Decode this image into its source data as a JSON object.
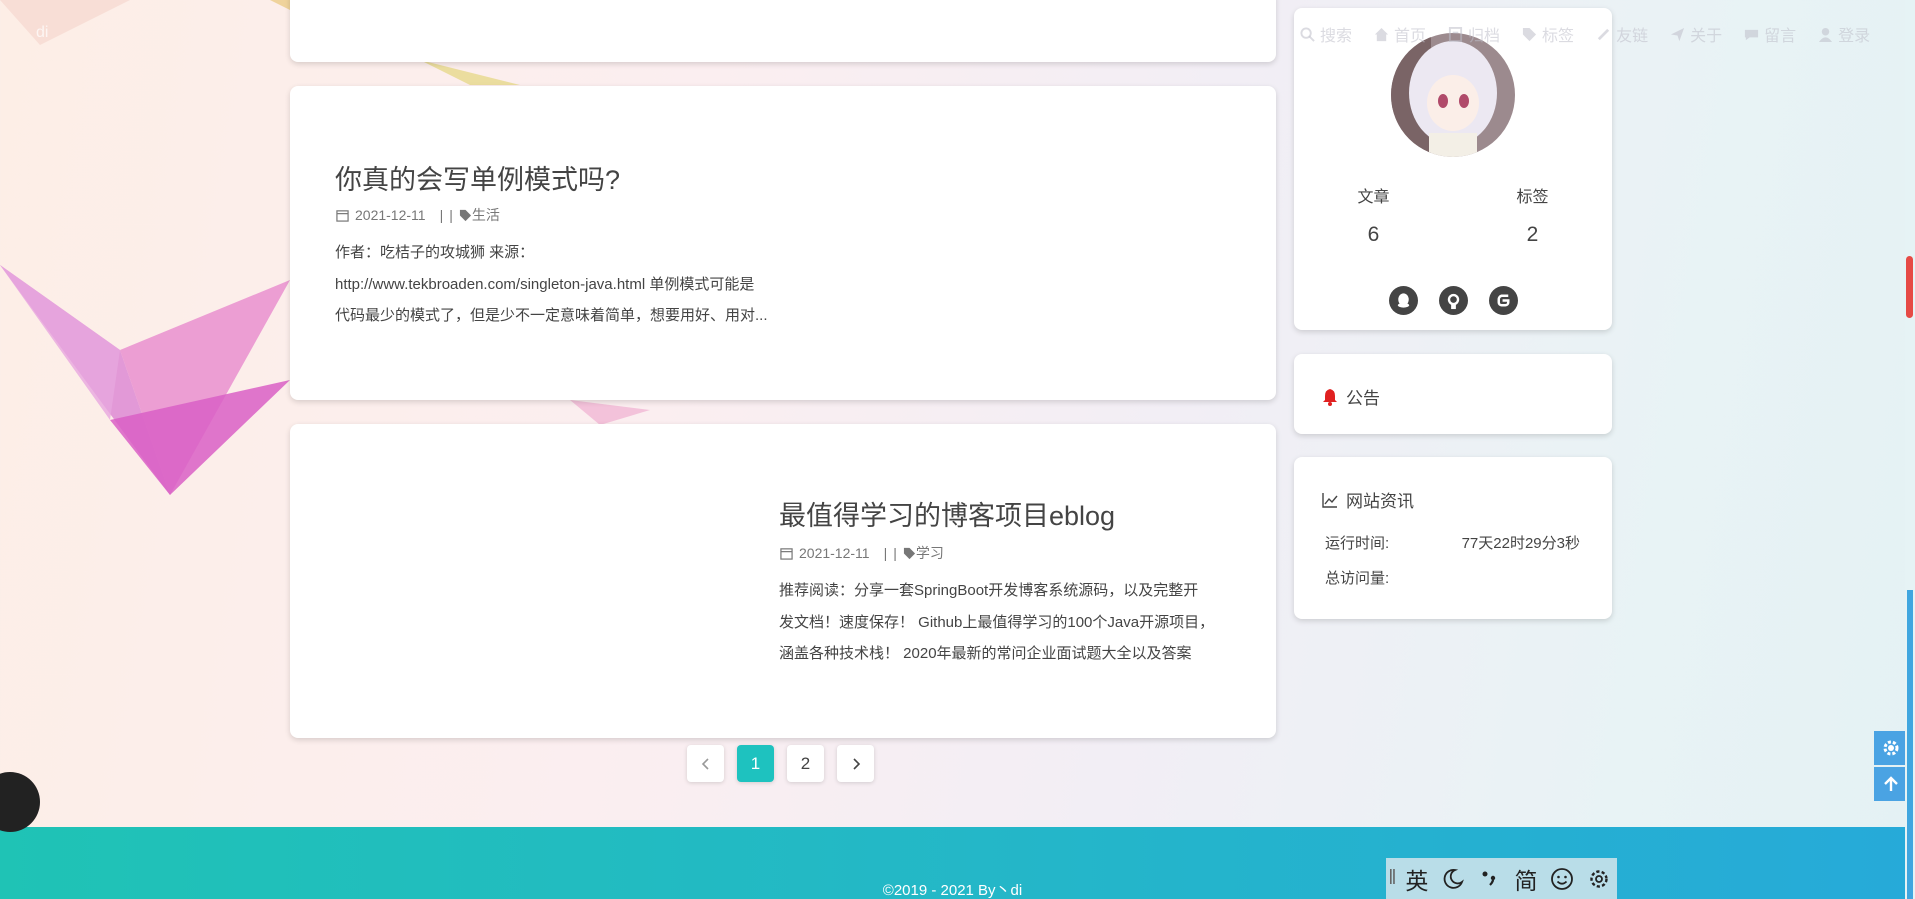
{
  "site": {
    "logo": "di"
  },
  "nav": [
    {
      "label": "搜索",
      "icon": "search-icon"
    },
    {
      "label": "首页",
      "icon": "home-icon"
    },
    {
      "label": "归档",
      "icon": "archive-icon"
    },
    {
      "label": "标签",
      "icon": "tag-icon"
    },
    {
      "label": "友链",
      "icon": "link-icon"
    },
    {
      "label": "关于",
      "icon": "send-icon"
    },
    {
      "label": "留言",
      "icon": "comment-icon"
    },
    {
      "label": "登录",
      "icon": "user-icon"
    }
  ],
  "posts": [
    {
      "title": "你真的会写单例模式吗?",
      "date": "2021-12-11",
      "separator": "|",
      "category": "生活",
      "excerpt": [
        "作者：吃桔子的攻城狮 来源：",
        "http://www.tekbroaden.com/singleton-java.html 单例模式可能是",
        "代码最少的模式了，但是少不一定意味着简单，想要用好、用对..."
      ]
    },
    {
      "title": "最值得学习的博客项目eblog",
      "date": "2021-12-11",
      "separator": "|",
      "category": "学习",
      "excerpt": [
        "推荐阅读：分享一套SpringBoot开发博客系统源码，以及完整开",
        "发文档！速度保存！ Github上最值得学习的100个Java开源项目，",
        "涵盖各种技术栈！ 2020年最新的常问企业面试题大全以及答案"
      ]
    }
  ],
  "pagination": {
    "prev": "prev-icon",
    "pages": [
      "1",
      "2"
    ],
    "active": "1",
    "next": "next-icon"
  },
  "profile": {
    "stats": [
      {
        "label": "文章",
        "value": "6"
      },
      {
        "label": "标签",
        "value": "2"
      }
    ],
    "socials": [
      "qq-icon",
      "github-icon",
      "gitee-icon"
    ]
  },
  "notice": {
    "title": "公告"
  },
  "site_info": {
    "title": "网站资讯",
    "rows": [
      {
        "label": "运行时间:",
        "value": "77天22时29分3秒"
      },
      {
        "label": "总访问量:",
        "value": ""
      }
    ]
  },
  "footer": {
    "text": "©2019 - 2021 By丶di"
  },
  "ime": {
    "items": [
      "英",
      "moon-icon",
      "punctuation-icon",
      "简",
      "emoji-icon",
      "settings-icon"
    ],
    "lang": "英",
    "script": "简"
  },
  "colors": {
    "accent": "#1ec2bf",
    "footer_start": "#1fc3b5",
    "footer_end": "#26aad9",
    "tool_button": "#4aa3e3",
    "bell": "#e02020"
  }
}
